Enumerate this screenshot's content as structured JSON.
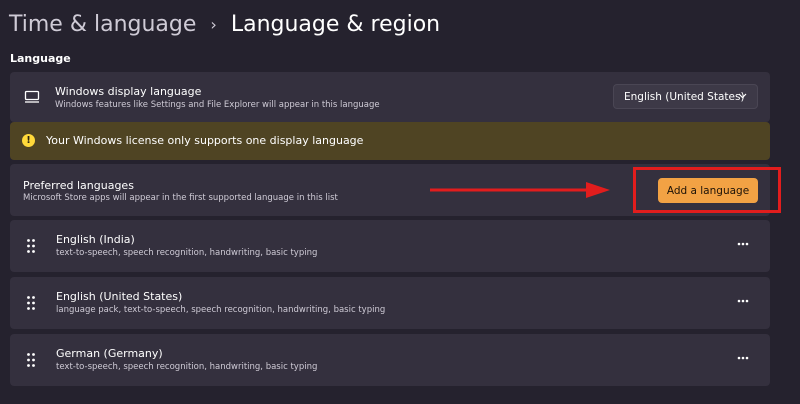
{
  "breadcrumb": {
    "parent": "Time & language",
    "separator": "›",
    "current": "Language & region"
  },
  "section_label": "Language",
  "display_language": {
    "title": "Windows display language",
    "subtitle": "Windows features like Settings and File Explorer will appear in this language",
    "selected": "English (United States)",
    "icon": "monitor-icon"
  },
  "warning": {
    "text": "Your Windows license only supports one display language",
    "icon": "warning-icon",
    "color": "#ffd93a"
  },
  "preferred": {
    "title": "Preferred languages",
    "subtitle": "Microsoft Store apps will appear in the first supported language in this list",
    "button_label": "Add a language",
    "button_color": "#f2a244",
    "highlight_color": "#e21d1d"
  },
  "languages": [
    {
      "name": "English (India)",
      "features": "text-to-speech, speech recognition, handwriting, basic typing"
    },
    {
      "name": "English (United States)",
      "features": "language pack, text-to-speech, speech recognition, handwriting, basic typing"
    },
    {
      "name": "German (Germany)",
      "features": "text-to-speech, speech recognition, handwriting, basic typing"
    }
  ]
}
